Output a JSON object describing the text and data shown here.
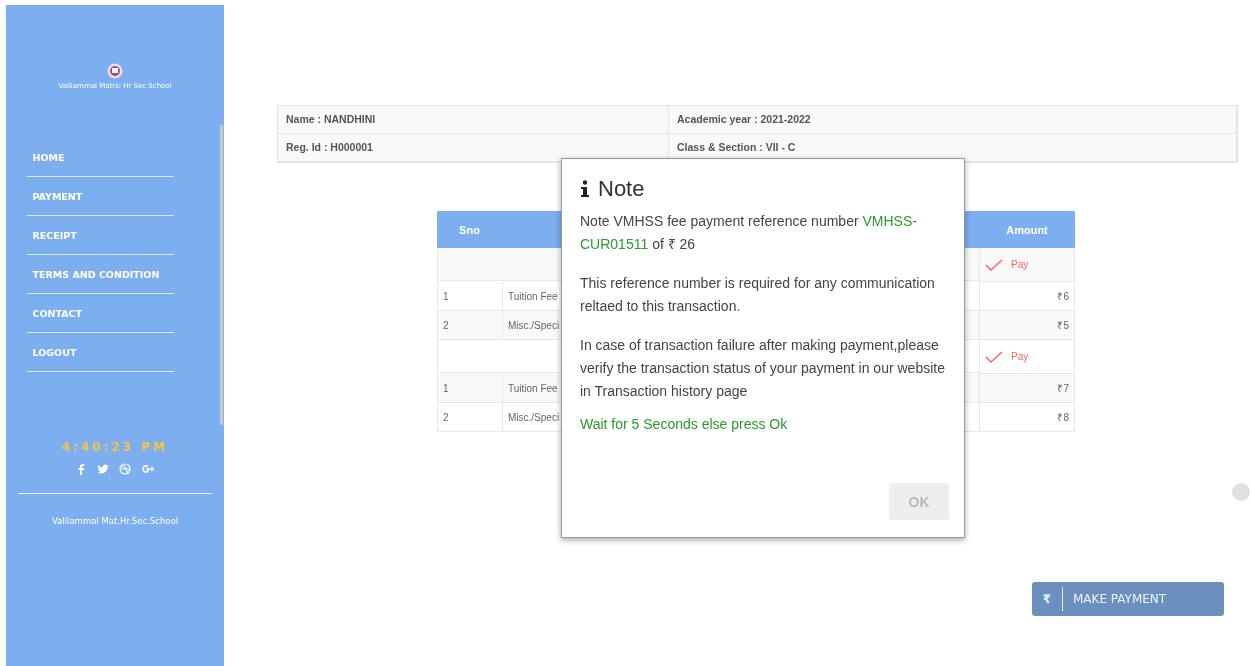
{
  "sidebar": {
    "school_name": "Valliammal Matric Hr Sec School",
    "nav_items": [
      {
        "label": "HOME"
      },
      {
        "label": "PAYMENT"
      },
      {
        "label": "RECEIPT"
      },
      {
        "label": "TERMS AND CONDITION"
      },
      {
        "label": "CONTACT"
      },
      {
        "label": "LOGOUT"
      }
    ],
    "clock": "4:40:23 PM",
    "footer_text": "Valliammal Mat.Hr.Sec.School"
  },
  "student_info": {
    "name": "Name : NANDHINI",
    "academic_year": "Academic year : 2021-2022",
    "reg_id": "Reg. Id : H000001",
    "class_section": "Class & Section : VII - C"
  },
  "fee_table": {
    "columns": [
      "Sno",
      "Amount"
    ],
    "rows": [
      {
        "kind": "group",
        "action": "Pay"
      },
      {
        "kind": "item",
        "sno": "1",
        "description": "Tuition Fee",
        "amount": "₹6"
      },
      {
        "kind": "item",
        "sno": "2",
        "description": "Misc./Speci",
        "amount": "₹5"
      },
      {
        "kind": "group",
        "action": "Pay"
      },
      {
        "kind": "item",
        "sno": "1",
        "description": "Tuition Fee",
        "amount": "₹7"
      },
      {
        "kind": "item",
        "sno": "2",
        "description": "Misc./Speci",
        "amount": "₹8"
      }
    ]
  },
  "make_payment": {
    "symbol": "₹",
    "label": "MAKE PAYMENT"
  },
  "modal": {
    "title": "Note",
    "text_before": "Note VMHSS fee payment reference number",
    "reference": "VMHSS-CUR01511",
    "text_after": "of ₹ 26",
    "paragraphs": [
      "This reference number is required for any communication reltaed to this transaction.",
      "In case of transaction failure after making payment,please verify the transaction status of your payment in our website in Transaction history page"
    ],
    "countdown": "Wait for 5 Seconds else press Ok",
    "ok_button": {
      "label": "OK",
      "disabled": true
    }
  }
}
